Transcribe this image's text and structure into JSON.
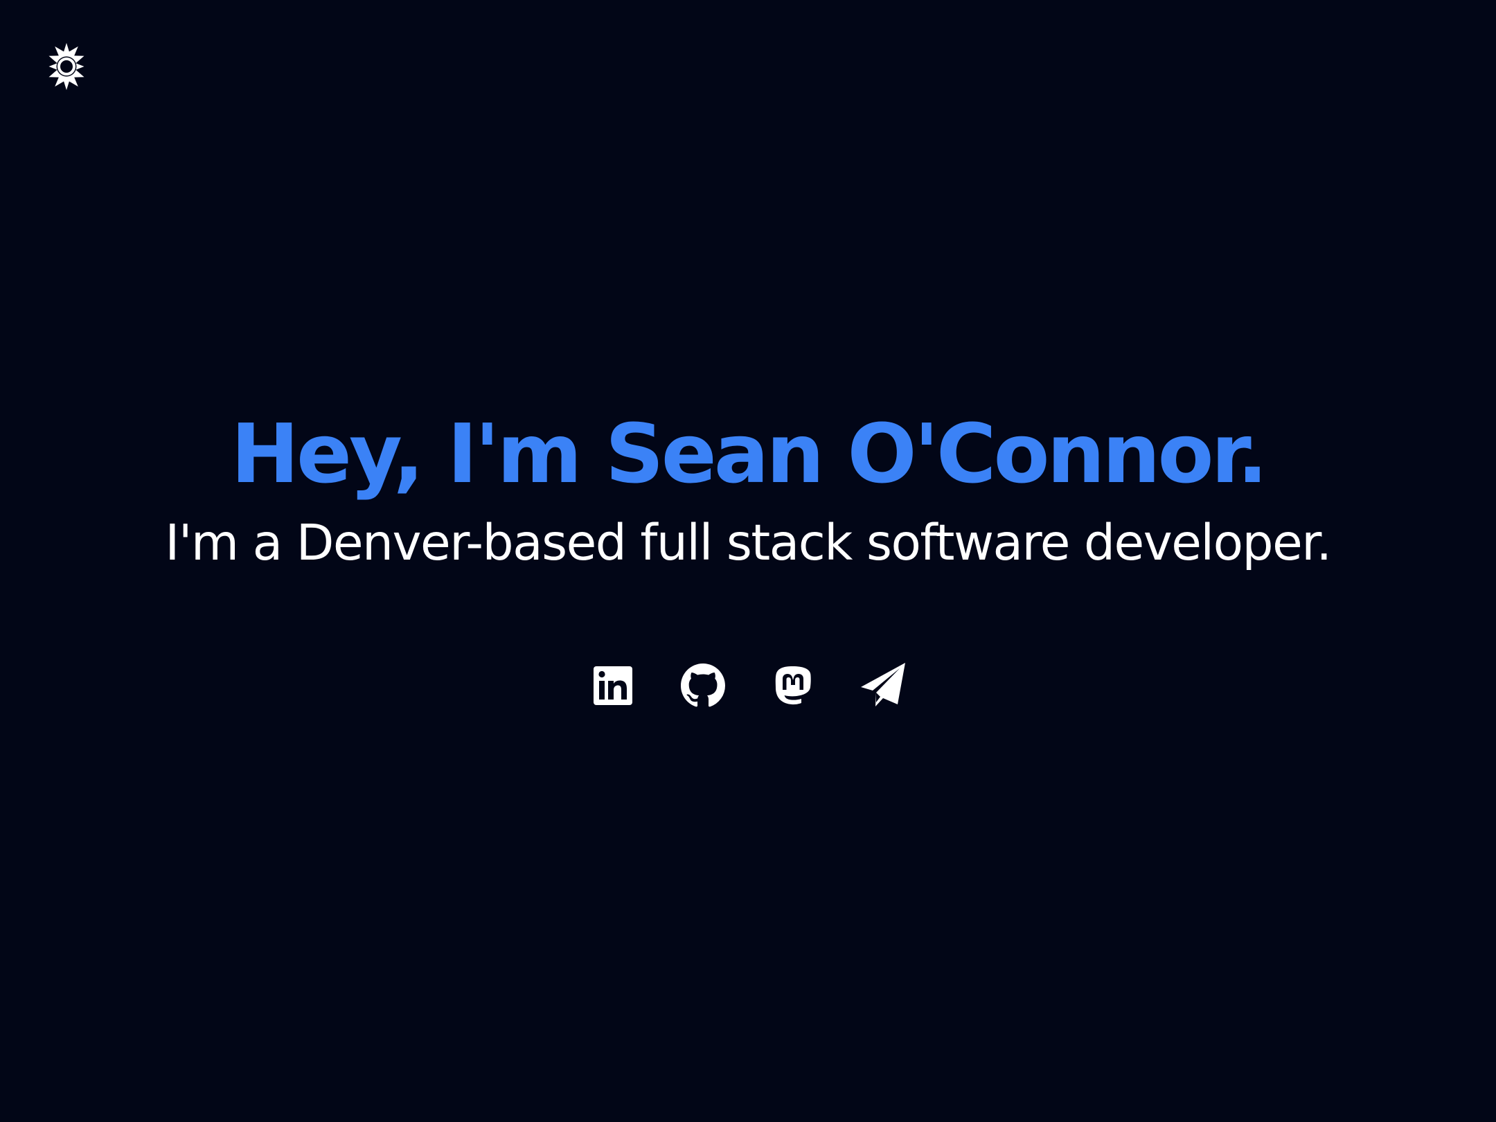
{
  "colors": {
    "background": "#020617",
    "accent": "#3b82f6",
    "text": "#ffffff"
  },
  "theme_toggle": {
    "icon": "sun-icon"
  },
  "hero": {
    "title": "Hey, I'm Sean O'Connor.",
    "subtitle": "I'm a Denver-based full stack software developer."
  },
  "social_links": [
    {
      "icon": "linkedin-icon"
    },
    {
      "icon": "github-icon"
    },
    {
      "icon": "mastodon-icon"
    },
    {
      "icon": "paper-plane-icon"
    }
  ]
}
